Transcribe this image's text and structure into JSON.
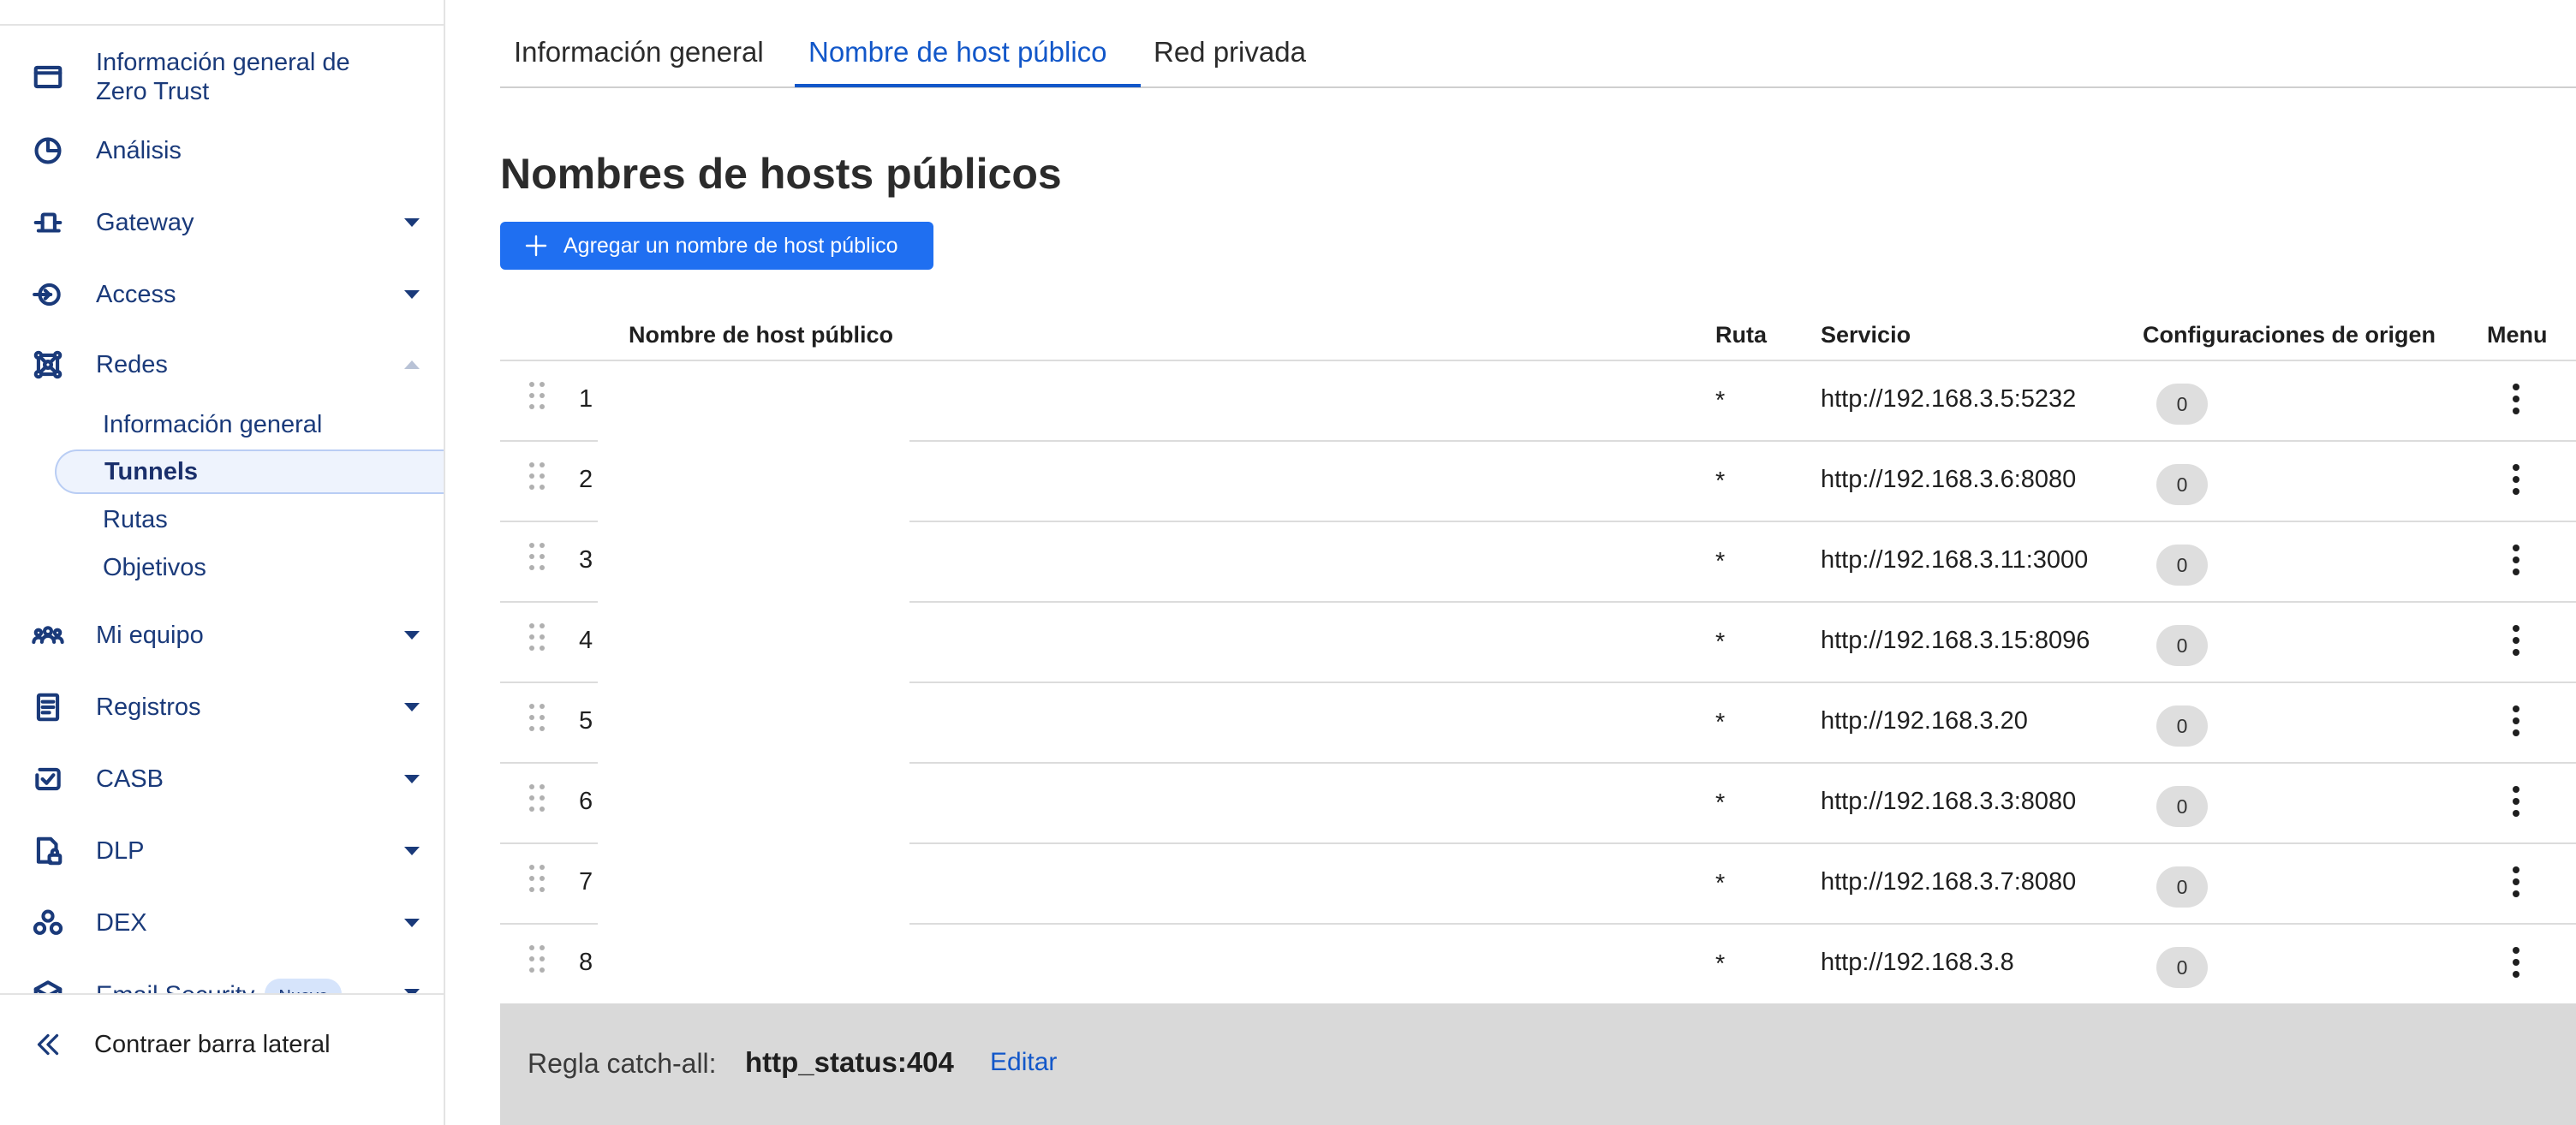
{
  "sidebar": {
    "items": [
      {
        "label_line1": "Información general de",
        "label_line2": "Zero Trust",
        "icon": "browser-window-icon"
      },
      {
        "label": "Análisis",
        "icon": "pie-chart-icon"
      },
      {
        "label": "Gateway",
        "icon": "gateway-icon"
      },
      {
        "label": "Access",
        "icon": "access-icon"
      },
      {
        "label": "Redes",
        "icon": "network-icon"
      },
      {
        "label": "Mi equipo",
        "icon": "team-icon"
      },
      {
        "label": "Registros",
        "icon": "logs-icon"
      },
      {
        "label": "CASB",
        "icon": "casb-icon"
      },
      {
        "label": "DLP",
        "icon": "dlp-icon"
      },
      {
        "label": "DEX",
        "icon": "dex-icon"
      },
      {
        "label": "Email Security",
        "icon": "email-security-icon",
        "badge": "Nuevo"
      }
    ],
    "subitems": [
      {
        "label": "Información general"
      },
      {
        "label": "Tunnels"
      },
      {
        "label": "Rutas"
      },
      {
        "label": "Objetivos"
      }
    ],
    "collapse_label": "Contraer barra lateral"
  },
  "tabs": [
    {
      "label": "Información general"
    },
    {
      "label": "Nombre de host público"
    },
    {
      "label": "Red privada"
    }
  ],
  "page_title": "Nombres de hosts públicos",
  "add_button_label": "Agregar un nombre de host público",
  "table": {
    "headers": {
      "hostname": "Nombre de host público",
      "route": "Ruta",
      "service": "Servicio",
      "origin": "Configuraciones de origen",
      "menu": "Menu"
    },
    "rows": [
      {
        "num": "1",
        "route": "*",
        "service": "http://192.168.3.5:5232",
        "origin": "0"
      },
      {
        "num": "2",
        "route": "*",
        "service": "http://192.168.3.6:8080",
        "origin": "0"
      },
      {
        "num": "3",
        "route": "*",
        "service": "http://192.168.3.11:3000",
        "origin": "0"
      },
      {
        "num": "4",
        "route": "*",
        "service": "http://192.168.3.15:8096",
        "origin": "0"
      },
      {
        "num": "5",
        "route": "*",
        "service": "http://192.168.3.20",
        "origin": "0"
      },
      {
        "num": "6",
        "route": "*",
        "service": "http://192.168.3.3:8080",
        "origin": "0"
      },
      {
        "num": "7",
        "route": "*",
        "service": "http://192.168.3.7:8080",
        "origin": "0"
      },
      {
        "num": "8",
        "route": "*",
        "service": "http://192.168.3.8",
        "origin": "0"
      }
    ]
  },
  "catchall": {
    "label": "Regla catch-all:",
    "value": "http_status:404",
    "edit_label": "Editar"
  },
  "colors": {
    "accent": "#1f6ff1",
    "link": "#1257c9",
    "nav_text": "#1a3a7a",
    "catchall_bg": "#d9d9d9"
  }
}
